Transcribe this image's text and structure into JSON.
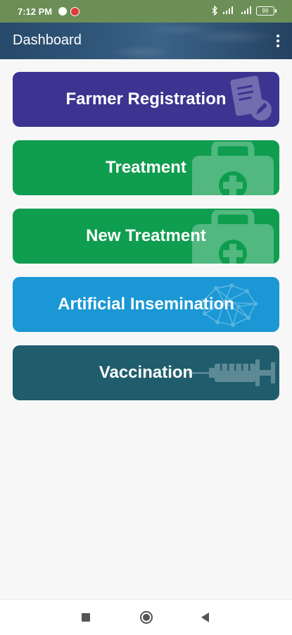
{
  "status_bar": {
    "time": "7:12 PM",
    "app_icons": [
      "skype-icon",
      "opera-icon"
    ],
    "battery": "99"
  },
  "app_bar": {
    "title": "Dashboard"
  },
  "cards": [
    {
      "label": "Farmer Registration",
      "color": "#3c3490",
      "icon": "clipboard-edit-icon"
    },
    {
      "label": "Treatment",
      "color": "#0f9d4f",
      "icon": "medical-kit-icon"
    },
    {
      "label": "New Treatment",
      "color": "#0f9d4f",
      "icon": "medical-kit-icon"
    },
    {
      "label": "Artificial Insemination",
      "color": "#1a97d4",
      "icon": "network-icon"
    },
    {
      "label": "Vaccination",
      "color": "#1f5d6c",
      "icon": "syringe-icon"
    }
  ],
  "nav_bar": {
    "icons": [
      "recents-icon",
      "home-icon",
      "back-icon"
    ]
  }
}
